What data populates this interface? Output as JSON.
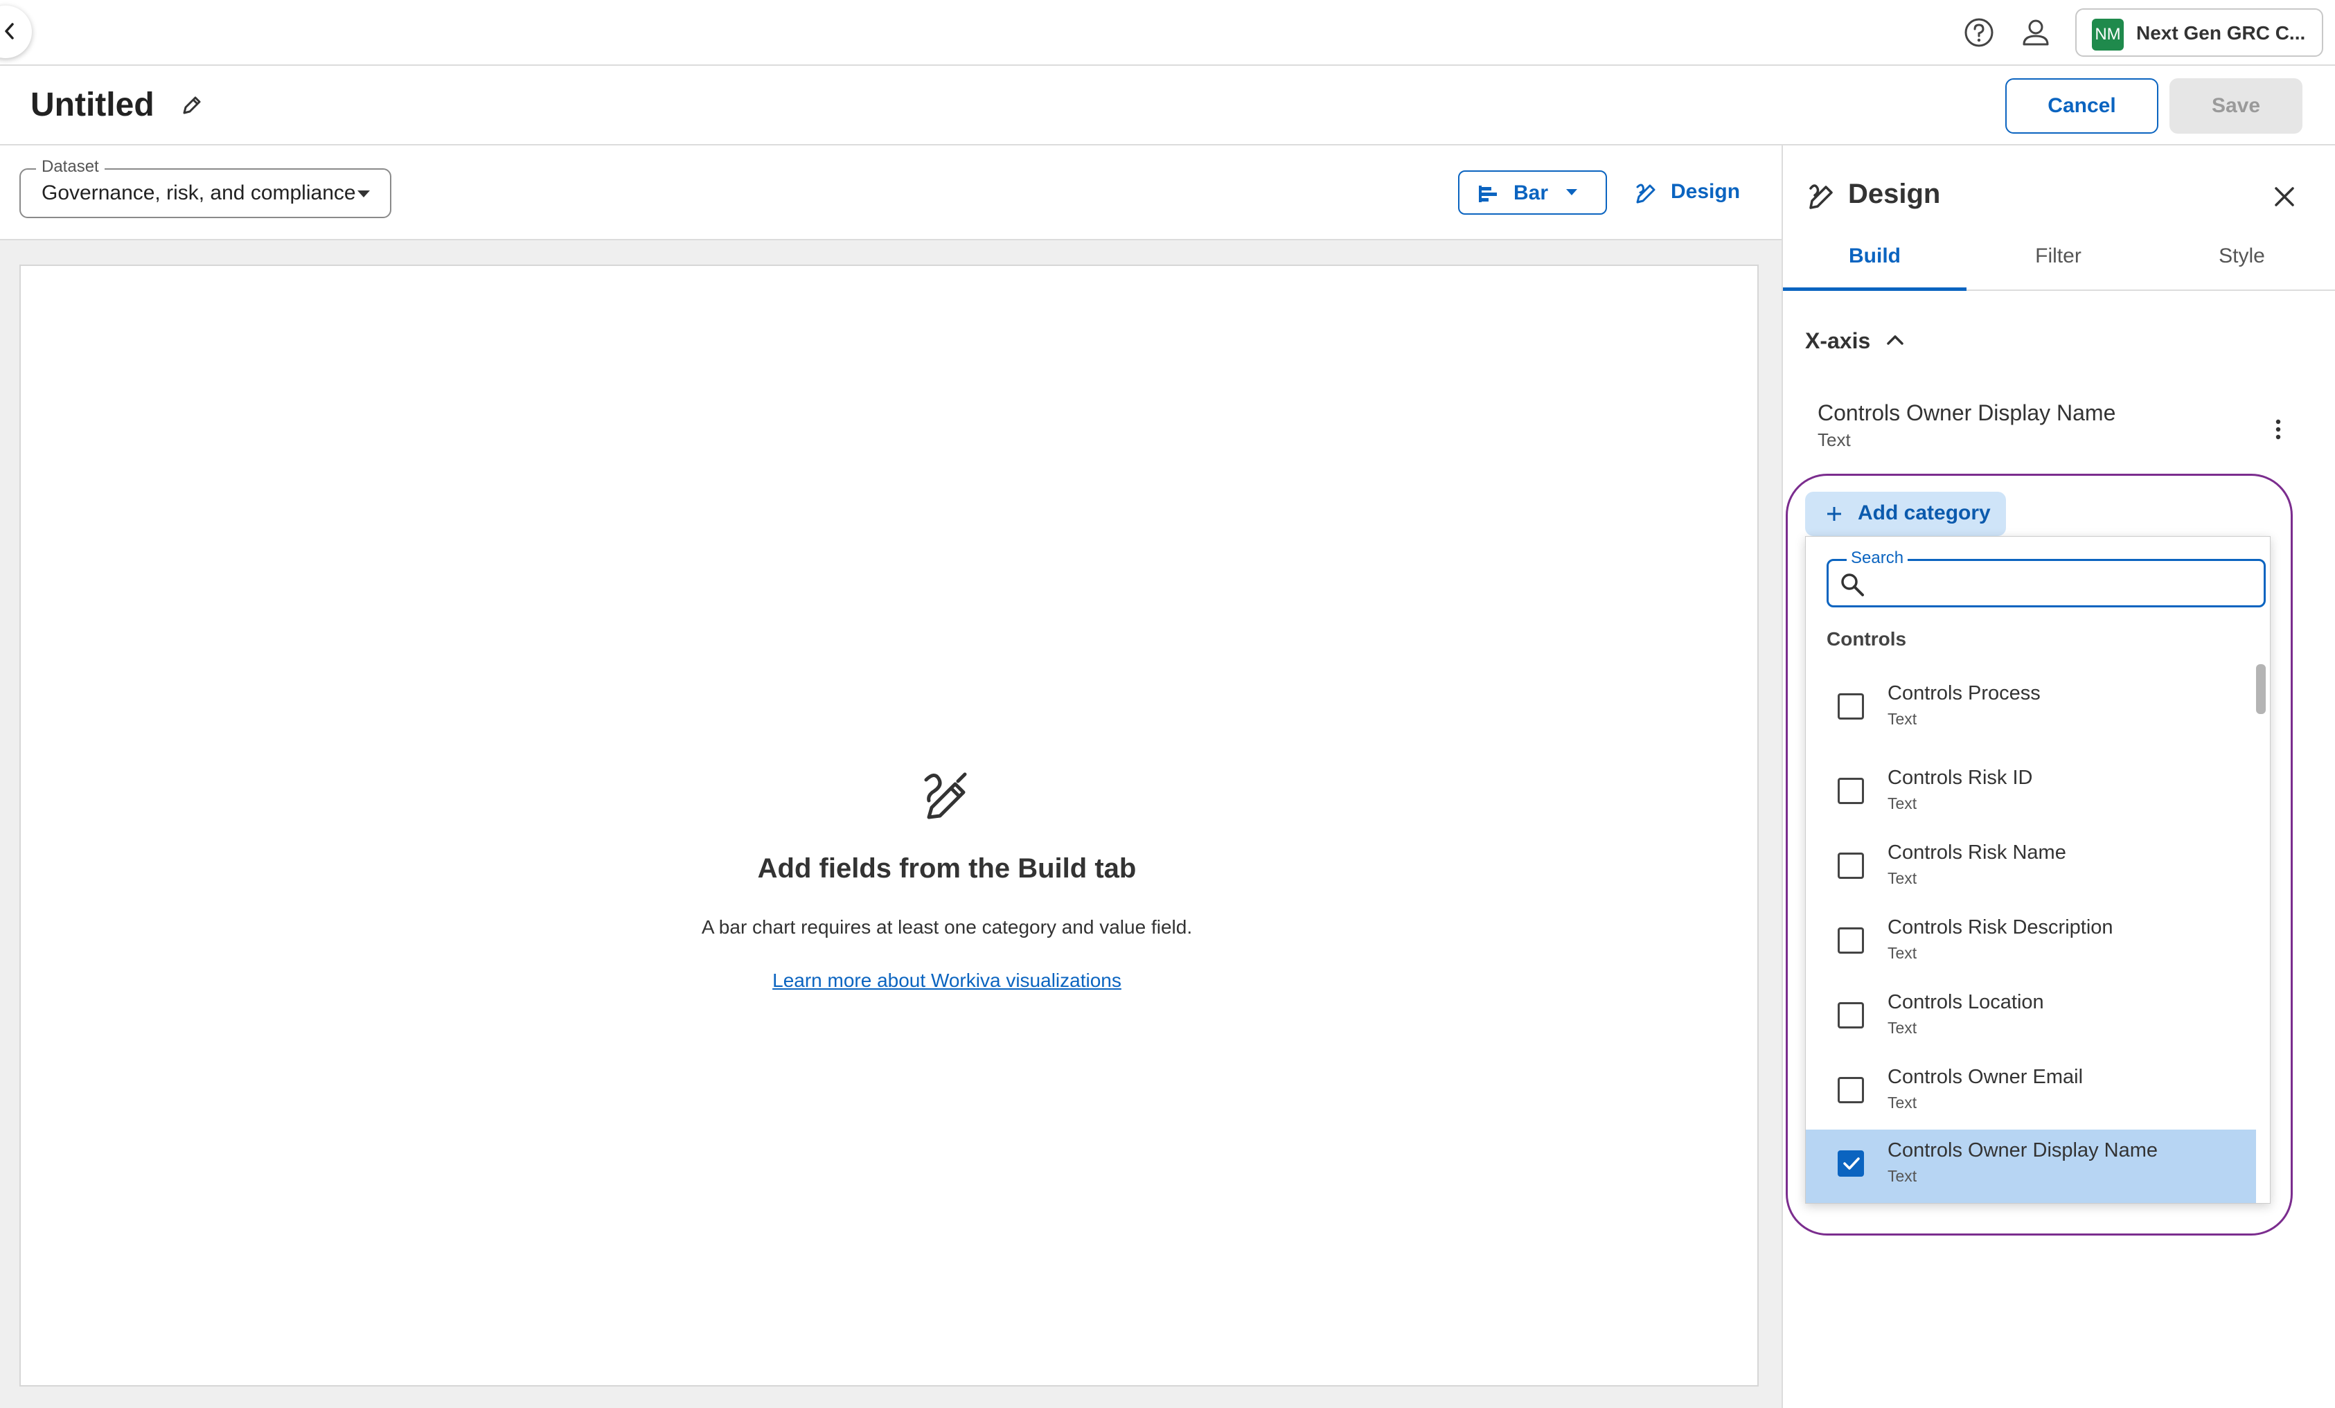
{
  "topbar": {
    "org_initials": "NM",
    "org_name": "Next Gen GRC C..."
  },
  "header": {
    "title": "Untitled",
    "cancel_label": "Cancel",
    "save_label": "Save"
  },
  "toolbar": {
    "dataset_label": "Dataset",
    "dataset_value": "Governance, risk, and compliance",
    "chart_type_label": "Bar",
    "design_label": "Design"
  },
  "empty_state": {
    "title": "Add fields from the Build tab",
    "description": "A bar chart requires at least one category and value field.",
    "link": "Learn more about Workiva visualizations"
  },
  "design_panel": {
    "title": "Design",
    "tabs": [
      {
        "label": "Build",
        "active": true
      },
      {
        "label": "Filter",
        "active": false
      },
      {
        "label": "Style",
        "active": false
      }
    ],
    "xaxis": {
      "title": "X-axis",
      "field_name": "Controls Owner Display Name",
      "field_type": "Text"
    },
    "add_category_label": "Add category",
    "dropdown": {
      "search_label": "Search",
      "search_value": "",
      "group_label": "Controls",
      "options": [
        {
          "name": "Controls Process",
          "type": "Text",
          "checked": false
        },
        {
          "name": "Controls Risk ID",
          "type": "Text",
          "checked": false
        },
        {
          "name": "Controls Risk Name",
          "type": "Text",
          "checked": false
        },
        {
          "name": "Controls Risk Description",
          "type": "Text",
          "checked": false
        },
        {
          "name": "Controls Location",
          "type": "Text",
          "checked": false
        },
        {
          "name": "Controls Owner Email",
          "type": "Text",
          "checked": false
        },
        {
          "name": "Controls Owner Display Name",
          "type": "Text",
          "checked": true
        }
      ]
    }
  },
  "colors": {
    "accent": "#0b64c0",
    "selected_row": "#b7d5f3",
    "highlight_ring": "#7b2d8e",
    "org_avatar": "#1f8a4c"
  }
}
